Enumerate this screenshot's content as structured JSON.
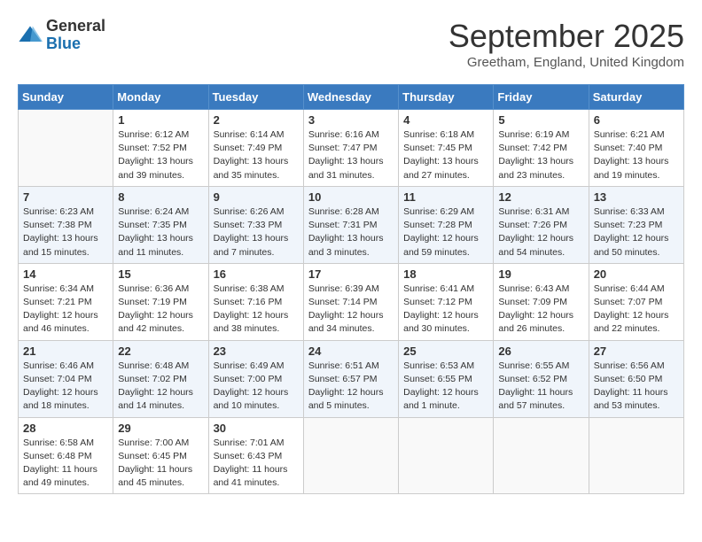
{
  "header": {
    "logo_line1": "General",
    "logo_line2": "Blue",
    "month": "September 2025",
    "location": "Greetham, England, United Kingdom"
  },
  "days": [
    "Sunday",
    "Monday",
    "Tuesday",
    "Wednesday",
    "Thursday",
    "Friday",
    "Saturday"
  ],
  "weeks": [
    [
      {
        "num": "",
        "info": ""
      },
      {
        "num": "1",
        "info": "Sunrise: 6:12 AM\nSunset: 7:52 PM\nDaylight: 13 hours\nand 39 minutes."
      },
      {
        "num": "2",
        "info": "Sunrise: 6:14 AM\nSunset: 7:49 PM\nDaylight: 13 hours\nand 35 minutes."
      },
      {
        "num": "3",
        "info": "Sunrise: 6:16 AM\nSunset: 7:47 PM\nDaylight: 13 hours\nand 31 minutes."
      },
      {
        "num": "4",
        "info": "Sunrise: 6:18 AM\nSunset: 7:45 PM\nDaylight: 13 hours\nand 27 minutes."
      },
      {
        "num": "5",
        "info": "Sunrise: 6:19 AM\nSunset: 7:42 PM\nDaylight: 13 hours\nand 23 minutes."
      },
      {
        "num": "6",
        "info": "Sunrise: 6:21 AM\nSunset: 7:40 PM\nDaylight: 13 hours\nand 19 minutes."
      }
    ],
    [
      {
        "num": "7",
        "info": "Sunrise: 6:23 AM\nSunset: 7:38 PM\nDaylight: 13 hours\nand 15 minutes."
      },
      {
        "num": "8",
        "info": "Sunrise: 6:24 AM\nSunset: 7:35 PM\nDaylight: 13 hours\nand 11 minutes."
      },
      {
        "num": "9",
        "info": "Sunrise: 6:26 AM\nSunset: 7:33 PM\nDaylight: 13 hours\nand 7 minutes."
      },
      {
        "num": "10",
        "info": "Sunrise: 6:28 AM\nSunset: 7:31 PM\nDaylight: 13 hours\nand 3 minutes."
      },
      {
        "num": "11",
        "info": "Sunrise: 6:29 AM\nSunset: 7:28 PM\nDaylight: 12 hours\nand 59 minutes."
      },
      {
        "num": "12",
        "info": "Sunrise: 6:31 AM\nSunset: 7:26 PM\nDaylight: 12 hours\nand 54 minutes."
      },
      {
        "num": "13",
        "info": "Sunrise: 6:33 AM\nSunset: 7:23 PM\nDaylight: 12 hours\nand 50 minutes."
      }
    ],
    [
      {
        "num": "14",
        "info": "Sunrise: 6:34 AM\nSunset: 7:21 PM\nDaylight: 12 hours\nand 46 minutes."
      },
      {
        "num": "15",
        "info": "Sunrise: 6:36 AM\nSunset: 7:19 PM\nDaylight: 12 hours\nand 42 minutes."
      },
      {
        "num": "16",
        "info": "Sunrise: 6:38 AM\nSunset: 7:16 PM\nDaylight: 12 hours\nand 38 minutes."
      },
      {
        "num": "17",
        "info": "Sunrise: 6:39 AM\nSunset: 7:14 PM\nDaylight: 12 hours\nand 34 minutes."
      },
      {
        "num": "18",
        "info": "Sunrise: 6:41 AM\nSunset: 7:12 PM\nDaylight: 12 hours\nand 30 minutes."
      },
      {
        "num": "19",
        "info": "Sunrise: 6:43 AM\nSunset: 7:09 PM\nDaylight: 12 hours\nand 26 minutes."
      },
      {
        "num": "20",
        "info": "Sunrise: 6:44 AM\nSunset: 7:07 PM\nDaylight: 12 hours\nand 22 minutes."
      }
    ],
    [
      {
        "num": "21",
        "info": "Sunrise: 6:46 AM\nSunset: 7:04 PM\nDaylight: 12 hours\nand 18 minutes."
      },
      {
        "num": "22",
        "info": "Sunrise: 6:48 AM\nSunset: 7:02 PM\nDaylight: 12 hours\nand 14 minutes."
      },
      {
        "num": "23",
        "info": "Sunrise: 6:49 AM\nSunset: 7:00 PM\nDaylight: 12 hours\nand 10 minutes."
      },
      {
        "num": "24",
        "info": "Sunrise: 6:51 AM\nSunset: 6:57 PM\nDaylight: 12 hours\nand 5 minutes."
      },
      {
        "num": "25",
        "info": "Sunrise: 6:53 AM\nSunset: 6:55 PM\nDaylight: 12 hours\nand 1 minute."
      },
      {
        "num": "26",
        "info": "Sunrise: 6:55 AM\nSunset: 6:52 PM\nDaylight: 11 hours\nand 57 minutes."
      },
      {
        "num": "27",
        "info": "Sunrise: 6:56 AM\nSunset: 6:50 PM\nDaylight: 11 hours\nand 53 minutes."
      }
    ],
    [
      {
        "num": "28",
        "info": "Sunrise: 6:58 AM\nSunset: 6:48 PM\nDaylight: 11 hours\nand 49 minutes."
      },
      {
        "num": "29",
        "info": "Sunrise: 7:00 AM\nSunset: 6:45 PM\nDaylight: 11 hours\nand 45 minutes."
      },
      {
        "num": "30",
        "info": "Sunrise: 7:01 AM\nSunset: 6:43 PM\nDaylight: 11 hours\nand 41 minutes."
      },
      {
        "num": "",
        "info": ""
      },
      {
        "num": "",
        "info": ""
      },
      {
        "num": "",
        "info": ""
      },
      {
        "num": "",
        "info": ""
      }
    ]
  ]
}
